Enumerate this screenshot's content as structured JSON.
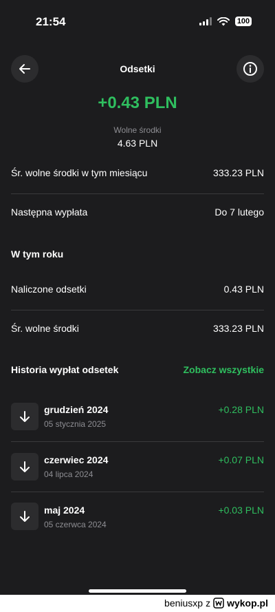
{
  "status_bar": {
    "time": "21:54",
    "battery": "100"
  },
  "header": {
    "title": "Odsetki"
  },
  "summary": {
    "amount": "+0.43 PLN",
    "free_funds_label": "Wolne środki",
    "free_funds_value": "4.63 PLN"
  },
  "details": [
    {
      "label": "Śr. wolne środki w tym miesiącu",
      "value": "333.23 PLN"
    },
    {
      "label": "Następna wypłata",
      "value": "Do 7 lutego"
    }
  ],
  "year_section": {
    "title": "W tym roku",
    "rows": [
      {
        "label": "Naliczone odsetki",
        "value": "0.43 PLN"
      },
      {
        "label": "Śr. wolne środki",
        "value": "333.23 PLN"
      }
    ]
  },
  "history": {
    "title": "Historia wypłat odsetek",
    "see_all": "Zobacz wszystkie",
    "items": [
      {
        "title": "grudzień 2024",
        "date": "05 stycznia 2025",
        "amount": "+0.28 PLN"
      },
      {
        "title": "czerwiec 2024",
        "date": "04 lipca 2024",
        "amount": "+0.07 PLN"
      },
      {
        "title": "maj 2024",
        "date": "05 czerwca 2024",
        "amount": "+0.03 PLN"
      }
    ]
  },
  "footer": {
    "user": "beniusxp",
    "separator": "z",
    "site": "wykop.pl"
  },
  "colors": {
    "accent": "#2fbf5f",
    "background": "#1c1c1e",
    "muted": "#8e8e93"
  }
}
